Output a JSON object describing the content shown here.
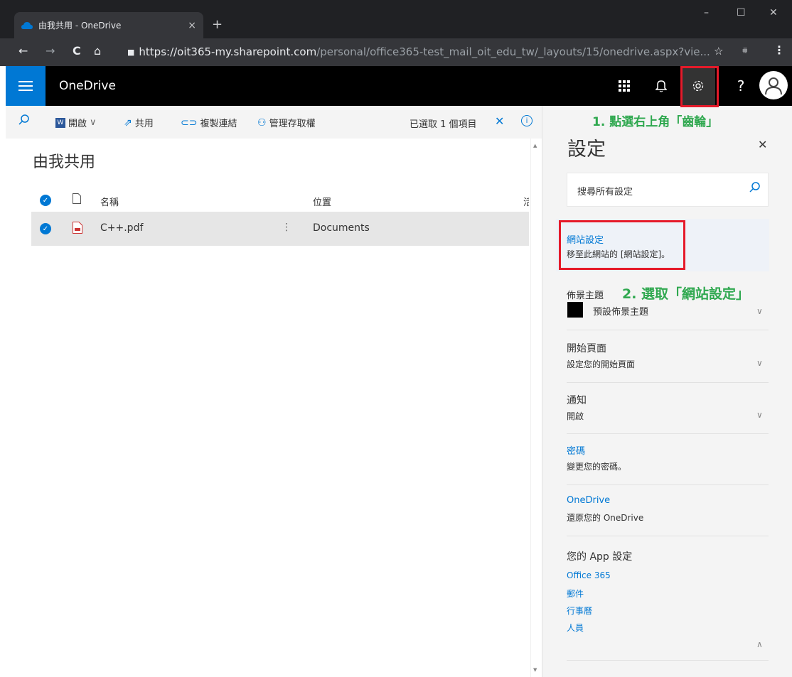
{
  "browser": {
    "tab_title": "由我共用 - OneDrive",
    "tab_close": "×",
    "new_tab": "+",
    "win_min": "–",
    "win_max": "☐",
    "win_close": "✕",
    "url_host": "https://oit365-my.sharepoint.com",
    "url_path": "/personal/office365-test_mail_oit_edu_tw/_layouts/15/onedrive.aspx?vie...",
    "star": "☆",
    "ext_icon": "⩷",
    "menu": "⋮",
    "back": "←",
    "forward": "→",
    "reload": "C",
    "home": "⌂",
    "lock": "🔒"
  },
  "suite": {
    "app_title": "OneDrive",
    "waffle": "∷",
    "bell": "🔔",
    "gear": "⚙",
    "help": "?"
  },
  "cmdbar": {
    "search_icon": "⌕",
    "open_label": "開啟",
    "open_chevron": "∨",
    "share_label": "共用",
    "copy_link_label": "複製連結",
    "manage_access_label": "管理存取權",
    "selected_label": "已選取 1 個項目",
    "deselect": "✕",
    "info": "i"
  },
  "list": {
    "page_title": "由我共用",
    "columns": [
      "名稱",
      "位置",
      "活"
    ],
    "rows": [
      {
        "name": "C++.pdf",
        "more": "⋮",
        "location": "Documents"
      }
    ]
  },
  "settings": {
    "title": "設定",
    "close": "✕",
    "search_placeholder": "搜尋所有設定",
    "site_settings_title": "網站設定",
    "site_settings_desc": "移至此網站的 [網站設定]。",
    "theme_title": "佈景主題",
    "theme_desc": "預設佈景主題",
    "start_title": "開始頁面",
    "start_desc": "設定您的開始頁面",
    "notify_title": "通知",
    "notify_desc": "開啟",
    "password_title": "密碼",
    "password_desc": "變更您的密碼。",
    "onedrive_title": "OneDrive",
    "onedrive_desc": "還原您的 OneDrive",
    "apps_title": "您的 App 設定",
    "apps": [
      "Office 365",
      "郵件",
      "行事曆",
      "人員"
    ],
    "chevron_down": "∨",
    "chevron_up": "∧"
  },
  "annotations": {
    "step1": "1. 點選右上角「齒輪」",
    "step2": "2. 選取「網站設定」",
    "color": "#e51a2a",
    "green": "#2fa84f"
  }
}
